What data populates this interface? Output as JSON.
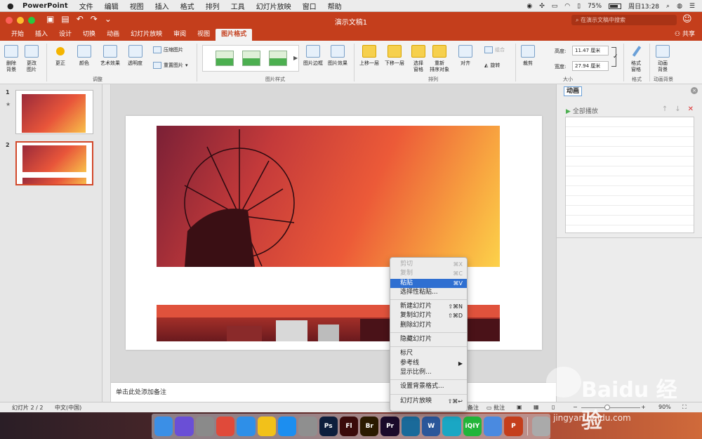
{
  "menubar": {
    "apple": "",
    "items": [
      "PowerPoint",
      "文件",
      "编辑",
      "视图",
      "插入",
      "格式",
      "排列",
      "工具",
      "幻灯片放映",
      "窗口",
      "帮助"
    ],
    "battery": "75%",
    "datetime": "周日13:28",
    "battery_level": 0.75
  },
  "titlebar": {
    "title": "演示文稿1",
    "search_placeholder": "在演示文稿中搜索"
  },
  "ribbon_tabs": {
    "tabs": [
      "开始",
      "插入",
      "设计",
      "切换",
      "动画",
      "幻灯片放映",
      "审阅",
      "视图",
      "图片格式"
    ],
    "active": "图片格式",
    "share": "共享"
  },
  "ribbon": {
    "remove_bg": "删除\n背景",
    "change_pic": "更改\n图片",
    "corrections": "更正",
    "color": "颜色",
    "artistic": "艺术效果",
    "transparency": "透明度",
    "compress": "压缩图片",
    "reset": "重置图片",
    "adjust_group": "调整",
    "styles_group": "图片样式",
    "pic_border": "图片边框",
    "pic_effects": "图片效果",
    "bring_forward": "上移一层",
    "send_backward": "下移一层",
    "selection_pane": "选择\n窗格",
    "reorder": "重新\n排序对象",
    "align": "对齐",
    "group": "组合",
    "rotate": "旋转",
    "arrange_group": "排列",
    "crop": "裁剪",
    "height_label": "高度:",
    "height_value": "11.47 厘米",
    "width_label": "宽度:",
    "width_value": "27.94 厘米",
    "size_group": "大小",
    "format_pane": "格式\n窗格",
    "format_group": "格式",
    "anim_bg": "动画\n背景",
    "anim_bg_group": "动画背景"
  },
  "slides_panel": {
    "slide1_num": "1",
    "slide1_star": "★",
    "slide2_num": "2"
  },
  "notes": {
    "placeholder": "单击此处添加备注"
  },
  "anim_pane": {
    "title": "动画",
    "close": "×",
    "play_all": "全部播放",
    "up": "↑",
    "down": "↓",
    "delete": "✕"
  },
  "statusbar": {
    "slide_count": "幻灯片 2 / 2",
    "language": "中文(中国)",
    "notes": "备注",
    "comments": "批注",
    "zoom": "90%"
  },
  "context_menu": {
    "items": [
      {
        "label": "剪切",
        "shortcut": "⌘X",
        "state": "disabled"
      },
      {
        "label": "复制",
        "shortcut": "⌘C",
        "state": "disabled"
      },
      {
        "label": "粘贴",
        "shortcut": "⌘V",
        "state": "highlight"
      },
      {
        "label": "选择性粘贴...",
        "shortcut": "",
        "state": "normal"
      },
      {
        "label": "新建幻灯片",
        "shortcut": "⇧⌘N",
        "state": "normal"
      },
      {
        "label": "复制幻灯片",
        "shortcut": "⇧⌘D",
        "state": "normal"
      },
      {
        "label": "删除幻灯片",
        "shortcut": "",
        "state": "normal"
      },
      {
        "label": "隐藏幻灯片",
        "shortcut": "",
        "state": "normal"
      },
      {
        "label": "标尺",
        "shortcut": "",
        "state": "normal"
      },
      {
        "label": "参考线",
        "shortcut": "▶",
        "state": "normal"
      },
      {
        "label": "显示比例...",
        "shortcut": "",
        "state": "normal"
      },
      {
        "label": "设置背景格式...",
        "shortcut": "",
        "state": "normal"
      },
      {
        "label": "幻灯片放映",
        "shortcut": "⇧⌘↩",
        "state": "normal"
      }
    ]
  },
  "dock": {
    "apps": [
      {
        "name": "finder-icon",
        "label": "",
        "color": "#3b8fe6"
      },
      {
        "name": "siri-icon",
        "label": "",
        "color": "#6a4fd6"
      },
      {
        "name": "launchpad-icon",
        "label": "",
        "color": "#8a8a8a"
      },
      {
        "name": "chrome-icon",
        "label": "",
        "color": "#e04a3a"
      },
      {
        "name": "safari-icon",
        "label": "",
        "color": "#2e8fe8"
      },
      {
        "name": "qq-icon",
        "label": "",
        "color": "#f2c11a"
      },
      {
        "name": "appstore-icon",
        "label": "",
        "color": "#1c8ef0"
      },
      {
        "name": "settings-icon",
        "label": "",
        "color": "#8f8f8f"
      },
      {
        "name": "photoshop-icon",
        "label": "Ps",
        "color": "#0d1e3c"
      },
      {
        "name": "flash-icon",
        "label": "Fl",
        "color": "#3a0a0a"
      },
      {
        "name": "bridge-icon",
        "label": "Br",
        "color": "#2a1a00"
      },
      {
        "name": "premiere-icon",
        "label": "Pr",
        "color": "#1a0a2a"
      },
      {
        "name": "edge-icon",
        "label": "",
        "color": "#1a6a9a"
      },
      {
        "name": "word-icon",
        "label": "W",
        "color": "#2b579a"
      },
      {
        "name": "browser-icon",
        "label": "",
        "color": "#1aa7c4"
      },
      {
        "name": "iqiyi-icon",
        "label": "iQIY",
        "color": "#22b53a"
      },
      {
        "name": "xcode-icon",
        "label": "",
        "color": "#4a8ae0"
      },
      {
        "name": "powerpoint-icon",
        "label": "P",
        "color": "#c43e1c"
      },
      {
        "name": "trash-icon",
        "label": "",
        "color": "#aaaaaa"
      }
    ]
  },
  "watermark": {
    "text": "Baidu 经验",
    "sub": "jingyan.baidu.com"
  }
}
